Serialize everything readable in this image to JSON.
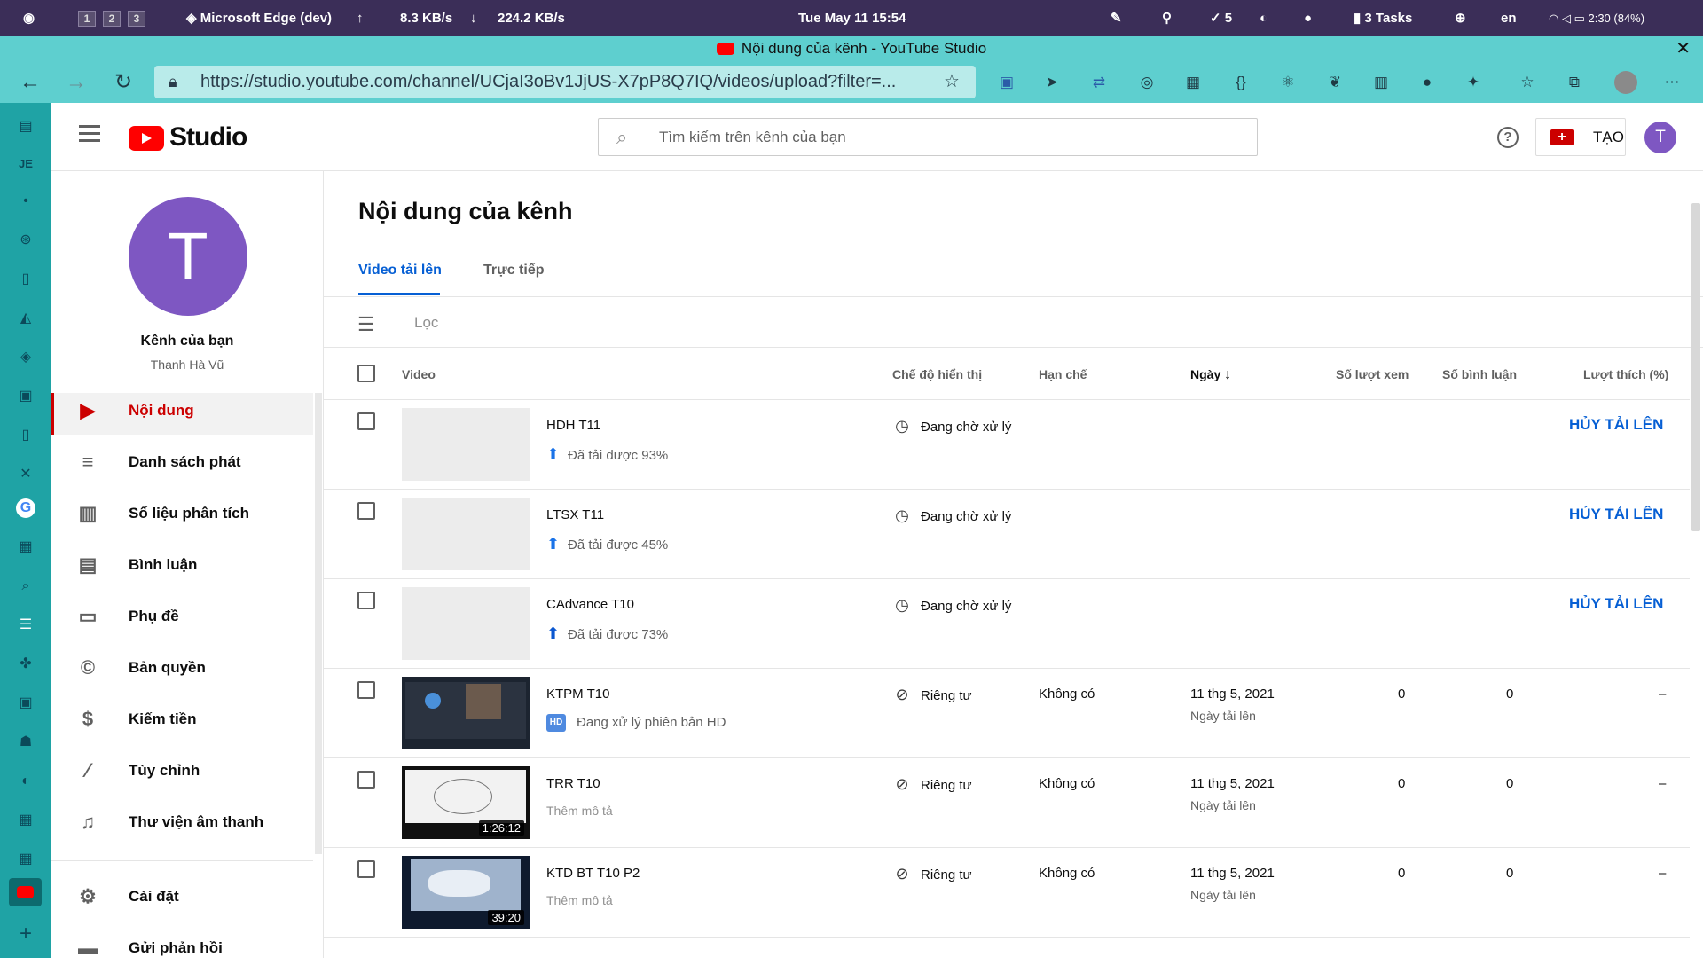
{
  "system_bar": {
    "workspaces": [
      "1",
      "2",
      "3"
    ],
    "active_app": "Microsoft Edge (dev)",
    "upload_speed": "8.3 KB/s",
    "download_speed": "224.2 KB/s",
    "datetime": "Tue May 11 15:54",
    "check_count": "5",
    "tasks": "3 Tasks",
    "language": "en",
    "battery": "2:30 (84%)"
  },
  "browser": {
    "window_title": "Nội dung của kênh - YouTube Studio",
    "url": "https://studio.youtube.com/channel/UCjaI3oBv1JjUS-X7pP8Q7IQ/videos/upload?filter=..."
  },
  "header": {
    "logo_text": "Studio",
    "search_placeholder": "Tìm kiếm trên kênh của bạn",
    "create_label": "TẠO",
    "avatar_letter": "T"
  },
  "sidebar": {
    "avatar_letter": "T",
    "channel_title": "Kênh của bạn",
    "channel_owner": "Thanh Hà Vũ",
    "items": [
      {
        "label": "Nội dung",
        "icon": "content-icon"
      },
      {
        "label": "Danh sách phát",
        "icon": "playlist-icon"
      },
      {
        "label": "Số liệu phân tích",
        "icon": "analytics-icon"
      },
      {
        "label": "Bình luận",
        "icon": "comments-icon"
      },
      {
        "label": "Phụ đề",
        "icon": "subtitles-icon"
      },
      {
        "label": "Bản quyền",
        "icon": "copyright-icon"
      },
      {
        "label": "Kiếm tiền",
        "icon": "dollar-icon"
      },
      {
        "label": "Tùy chỉnh",
        "icon": "magic-wand-icon"
      },
      {
        "label": "Thư viện âm thanh",
        "icon": "audio-library-icon"
      }
    ],
    "bottom_items": [
      {
        "label": "Cài đặt",
        "icon": "gear-icon"
      },
      {
        "label": "Gửi phản hồi",
        "icon": "feedback-icon"
      }
    ]
  },
  "main": {
    "page_title": "Nội dung của kênh",
    "tabs": [
      "Video tải lên",
      "Trực tiếp"
    ],
    "filter_label": "Lọc",
    "columns": {
      "video": "Video",
      "visibility": "Chế độ hiển thị",
      "restrictions": "Hạn chế",
      "date": "Ngày",
      "views": "Số lượt xem",
      "comments": "Số bình luận",
      "likes": "Lượt thích (%)"
    },
    "rows": [
      {
        "title": "HDH T11",
        "status": "Đã tải được 93%",
        "status_type": "uploading",
        "visibility": "Đang chờ xử lý",
        "visibility_icon": "clock-icon",
        "action": "HỦY TẢI LÊN"
      },
      {
        "title": "LTSX T11",
        "status": "Đã tải được 45%",
        "status_type": "uploading",
        "visibility": "Đang chờ xử lý",
        "visibility_icon": "clock-icon",
        "action": "HỦY TẢI LÊN"
      },
      {
        "title": "CAdvance T10",
        "status": "Đã tải được 73%",
        "status_type": "uploading",
        "visibility": "Đang chờ xử lý",
        "visibility_icon": "clock-icon",
        "action": "HỦY TẢI LÊN"
      },
      {
        "title": "KTPM T10",
        "status": "Đang xử lý phiên bản HD",
        "status_type": "hd",
        "visibility": "Riêng tư",
        "visibility_icon": "eye-off-icon",
        "restriction": "Không có",
        "date": "11 thg 5, 2021",
        "date_sub": "Ngày tải lên",
        "views": "0",
        "comments": "0",
        "likes": "–"
      },
      {
        "title": "TRR T10",
        "status": "Thêm mô tả",
        "status_type": "desc",
        "duration": "1:26:12",
        "visibility": "Riêng tư",
        "visibility_icon": "eye-off-icon",
        "restriction": "Không có",
        "date": "11 thg 5, 2021",
        "date_sub": "Ngày tải lên",
        "views": "0",
        "comments": "0",
        "likes": "–"
      },
      {
        "title": "KTD BT T10 P2",
        "status": "Thêm mô tả",
        "status_type": "desc",
        "duration": "39:20",
        "visibility": "Riêng tư",
        "visibility_icon": "eye-off-icon",
        "restriction": "Không có",
        "date": "11 thg 5, 2021",
        "date_sub": "Ngày tải lên",
        "views": "0",
        "comments": "0",
        "likes": "–"
      }
    ]
  },
  "colors": {
    "brand_red": "#ff0000",
    "accent_blue": "#065fd4",
    "avatar_purple": "#7e57c2",
    "browser_teal": "#5ecfcf"
  }
}
